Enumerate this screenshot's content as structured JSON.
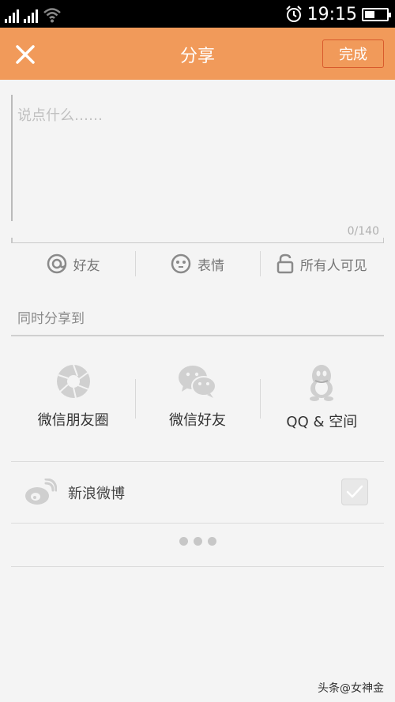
{
  "status_bar": {
    "time": "19:15",
    "battery_level": 0.45
  },
  "header": {
    "title": "分享",
    "done_label": "完成"
  },
  "compose": {
    "placeholder": "说点什么……",
    "value": "",
    "counter": "0/140"
  },
  "options": [
    {
      "label": "好友",
      "icon": "at-icon"
    },
    {
      "label": "表情",
      "icon": "emoji-icon"
    },
    {
      "label": "所有人可见",
      "icon": "lock-icon"
    }
  ],
  "share_section": {
    "label": "同时分享到"
  },
  "share_targets": [
    {
      "label": "微信朋友圈",
      "icon": "wechat-moments-icon"
    },
    {
      "label": "微信好友",
      "icon": "wechat-icon"
    },
    {
      "label": "QQ & 空间",
      "icon": "qq-icon"
    }
  ],
  "weibo": {
    "label": "新浪微博",
    "checked": true
  },
  "watermark": "头条@女神金",
  "colors": {
    "header": "#f19a5a",
    "done_border": "#d85a2c",
    "background": "#f4f4f4"
  }
}
